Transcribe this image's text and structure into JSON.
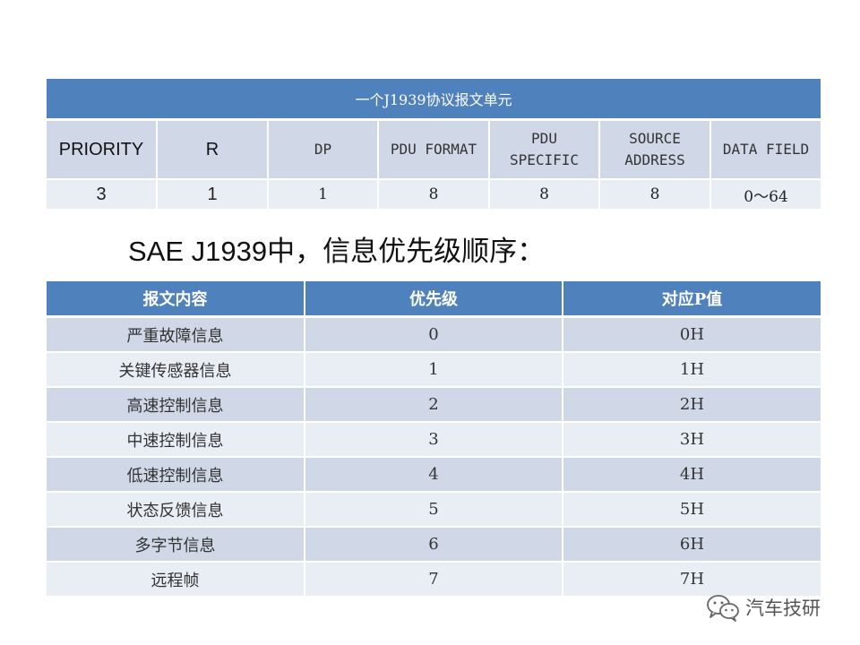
{
  "frame_table": {
    "title": "一个J1939协议报文单元",
    "headers": [
      {
        "text": "PRIORITY",
        "style": "sans"
      },
      {
        "text": "R",
        "style": "sans"
      },
      {
        "text": "DP",
        "style": "mono"
      },
      {
        "text": "PDU FORMAT",
        "style": "mono"
      },
      {
        "line1": "PDU",
        "line2": "SPECIFIC",
        "style": "mono"
      },
      {
        "line1": "SOURCE",
        "line2": "ADDRESS",
        "style": "mono"
      },
      {
        "text": "DATA FIELD",
        "style": "mono"
      }
    ],
    "values": [
      "3",
      "1",
      "1",
      "8",
      "8",
      "8",
      "0～64"
    ]
  },
  "heading": "SAE J1939中，信息优先级顺序：",
  "priority_table": {
    "headers": [
      "报文内容",
      "优先级",
      "对应P值"
    ],
    "rows": [
      [
        "严重故障信息",
        "0",
        "0H"
      ],
      [
        "关键传感器信息",
        "1",
        "1H"
      ],
      [
        "高速控制信息",
        "2",
        "2H"
      ],
      [
        "中速控制信息",
        "3",
        "3H"
      ],
      [
        "低速控制信息",
        "4",
        "4H"
      ],
      [
        "状态反馈信息",
        "5",
        "5H"
      ],
      [
        "多字节信息",
        "6",
        "6H"
      ],
      [
        "远程帧",
        "7",
        "7H"
      ]
    ]
  },
  "watermark": {
    "text": "汽车技研",
    "icon": "wechat-icon",
    "color": "#555555"
  },
  "colors": {
    "header_blue": "#4F81BD",
    "row_dark": "#D0D8E8",
    "row_light": "#E9EDF4"
  }
}
